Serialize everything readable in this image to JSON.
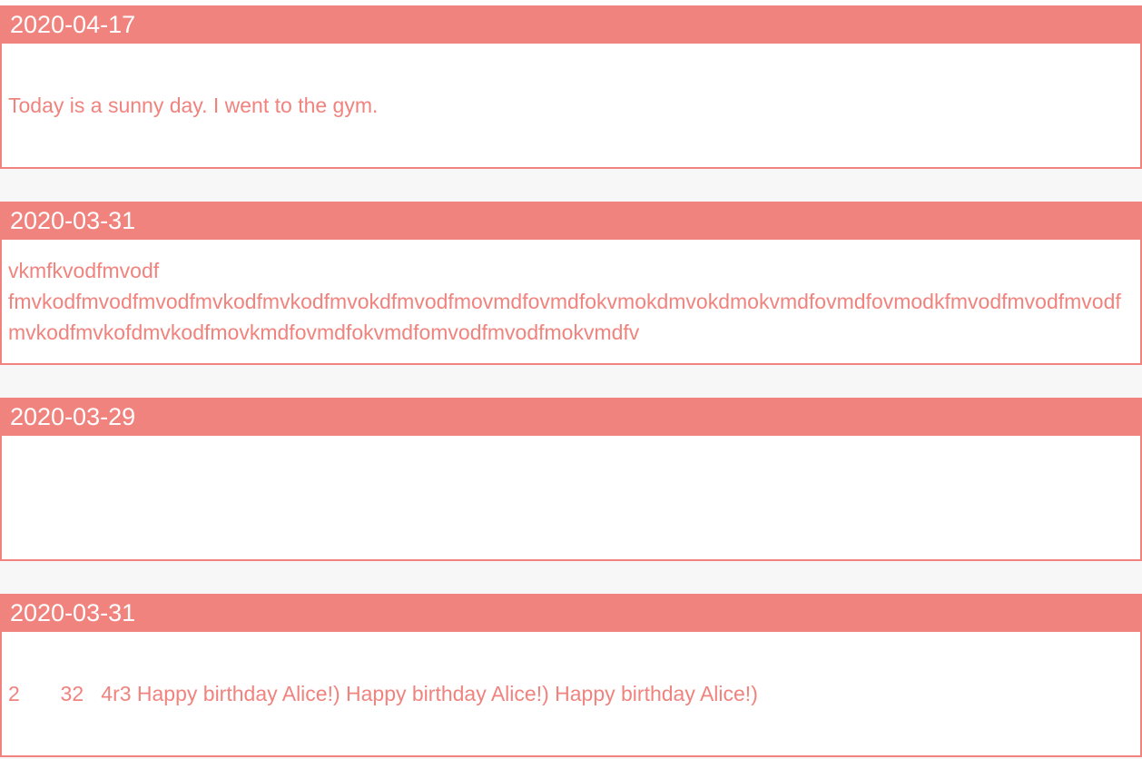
{
  "entries": [
    {
      "date": "2020-04-17",
      "text": "Today is a sunny day. I went to the gym."
    },
    {
      "date": "2020-03-31",
      "text": "vkmfkvodfmvodf\nfmvkodfmvodfmvodfmvkodfmvkodfmvokdfmvodfmovmdfovmdfokvmokdmvokdmokvmdfovmdfovmodkfmvodfmvodfmvodfmvkodfmvkofdmvkodfmovkmdfovmdfokvmdfomvodfmvodfmokvmdfv"
    },
    {
      "date": "2020-03-29",
      "text": ""
    },
    {
      "date": "2020-03-31",
      "text": "2       32   4r3 Happy birthday Alice!) Happy birthday Alice!) Happy birthday Alice!)"
    }
  ],
  "colors": {
    "accent": "#f0837e",
    "background": "#f7f7f7",
    "card": "#ffffff"
  }
}
